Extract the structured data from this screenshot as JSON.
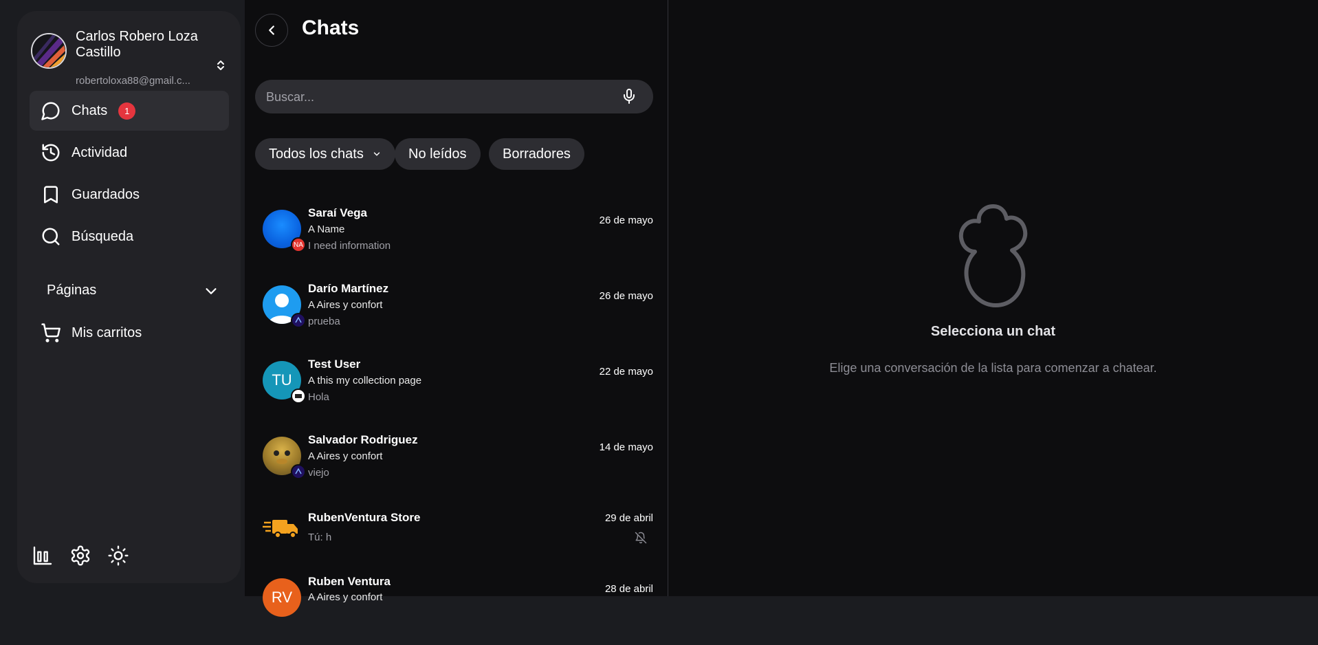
{
  "sidebar": {
    "profile": {
      "name": "Carlos Robero Loza Castillo",
      "email": "robertoloxa88@gmail.c..."
    },
    "nav": [
      {
        "label": "Chats",
        "icon": "chat-bubble-icon",
        "active": true,
        "badge": "1"
      },
      {
        "label": "Actividad",
        "icon": "history-icon"
      },
      {
        "label": "Guardados",
        "icon": "bookmark-icon"
      },
      {
        "label": "Búsqueda",
        "icon": "search-icon"
      }
    ],
    "pages_label": "Páginas",
    "carts_label": "Mis carritos",
    "bottom_icons": [
      "bar-chart-icon",
      "gear-icon",
      "sun-icon"
    ]
  },
  "chat_list": {
    "title": "Chats",
    "search_placeholder": "Buscar...",
    "filters": [
      {
        "label": "Todos los chats",
        "dropdown": true
      },
      {
        "label": "No leídos"
      },
      {
        "label": "Borradores"
      }
    ],
    "chats": [
      {
        "name": "Saraí Vega",
        "page": "A Name",
        "message": "I need information",
        "date": "26 de mayo",
        "sub_badge": "NA"
      },
      {
        "name": "Darío Martínez",
        "page": "A Aires y confort",
        "message": "prueba",
        "date": "26 de mayo"
      },
      {
        "name": "Test User",
        "page": "A this my collection page",
        "message": "Hola",
        "date": "22 de mayo",
        "initials": "TU"
      },
      {
        "name": "Salvador Rodriguez",
        "page": "A Aires y confort",
        "message": "viejo",
        "date": "14 de mayo"
      },
      {
        "name": "RubenVentura Store",
        "message": "Tú: h",
        "date": "29 de abril",
        "muted": true
      },
      {
        "name": "Ruben Ventura",
        "page": "A Aires y confort",
        "date": "28 de abril",
        "initials": "RV"
      }
    ]
  },
  "detail": {
    "empty_title": "Selecciona un chat",
    "empty_description": "Elige una conversación de la lista para comenzar a chatear."
  },
  "colors": {
    "page_background": "#1b1c20",
    "sidebar_background": "#222226",
    "panel_background": "#0d0d0f",
    "chip_background": "#2d2d32",
    "badge_red": "#e5353e"
  }
}
